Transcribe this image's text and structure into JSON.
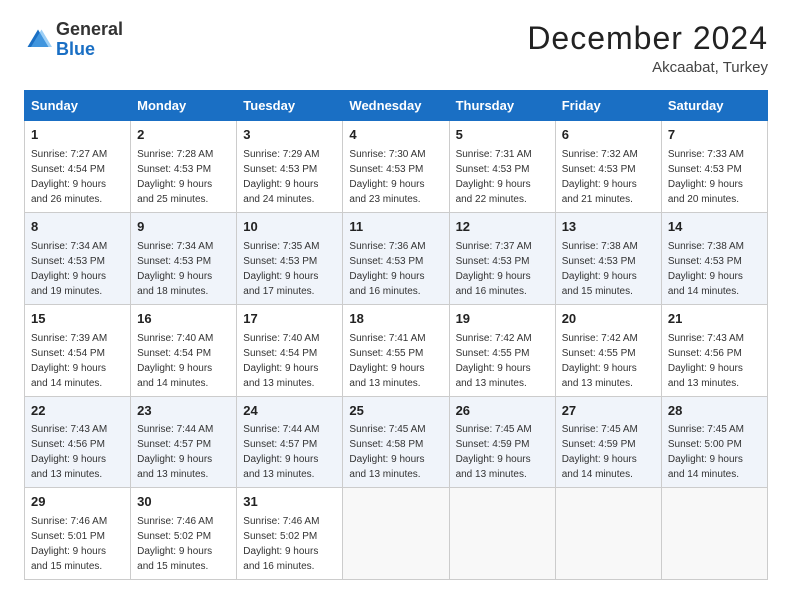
{
  "logo": {
    "general": "General",
    "blue": "Blue"
  },
  "title": {
    "month": "December 2024",
    "location": "Akcaabat, Turkey"
  },
  "weekdays": [
    "Sunday",
    "Monday",
    "Tuesday",
    "Wednesday",
    "Thursday",
    "Friday",
    "Saturday"
  ],
  "weeks": [
    [
      {
        "day": 1,
        "sunrise": "7:27 AM",
        "sunset": "4:54 PM",
        "daylight": "9 hours and 26 minutes."
      },
      {
        "day": 2,
        "sunrise": "7:28 AM",
        "sunset": "4:53 PM",
        "daylight": "9 hours and 25 minutes."
      },
      {
        "day": 3,
        "sunrise": "7:29 AM",
        "sunset": "4:53 PM",
        "daylight": "9 hours and 24 minutes."
      },
      {
        "day": 4,
        "sunrise": "7:30 AM",
        "sunset": "4:53 PM",
        "daylight": "9 hours and 23 minutes."
      },
      {
        "day": 5,
        "sunrise": "7:31 AM",
        "sunset": "4:53 PM",
        "daylight": "9 hours and 22 minutes."
      },
      {
        "day": 6,
        "sunrise": "7:32 AM",
        "sunset": "4:53 PM",
        "daylight": "9 hours and 21 minutes."
      },
      {
        "day": 7,
        "sunrise": "7:33 AM",
        "sunset": "4:53 PM",
        "daylight": "9 hours and 20 minutes."
      }
    ],
    [
      {
        "day": 8,
        "sunrise": "7:34 AM",
        "sunset": "4:53 PM",
        "daylight": "9 hours and 19 minutes."
      },
      {
        "day": 9,
        "sunrise": "7:34 AM",
        "sunset": "4:53 PM",
        "daylight": "9 hours and 18 minutes."
      },
      {
        "day": 10,
        "sunrise": "7:35 AM",
        "sunset": "4:53 PM",
        "daylight": "9 hours and 17 minutes."
      },
      {
        "day": 11,
        "sunrise": "7:36 AM",
        "sunset": "4:53 PM",
        "daylight": "9 hours and 16 minutes."
      },
      {
        "day": 12,
        "sunrise": "7:37 AM",
        "sunset": "4:53 PM",
        "daylight": "9 hours and 16 minutes."
      },
      {
        "day": 13,
        "sunrise": "7:38 AM",
        "sunset": "4:53 PM",
        "daylight": "9 hours and 15 minutes."
      },
      {
        "day": 14,
        "sunrise": "7:38 AM",
        "sunset": "4:53 PM",
        "daylight": "9 hours and 14 minutes."
      }
    ],
    [
      {
        "day": 15,
        "sunrise": "7:39 AM",
        "sunset": "4:54 PM",
        "daylight": "9 hours and 14 minutes."
      },
      {
        "day": 16,
        "sunrise": "7:40 AM",
        "sunset": "4:54 PM",
        "daylight": "9 hours and 14 minutes."
      },
      {
        "day": 17,
        "sunrise": "7:40 AM",
        "sunset": "4:54 PM",
        "daylight": "9 hours and 13 minutes."
      },
      {
        "day": 18,
        "sunrise": "7:41 AM",
        "sunset": "4:55 PM",
        "daylight": "9 hours and 13 minutes."
      },
      {
        "day": 19,
        "sunrise": "7:42 AM",
        "sunset": "4:55 PM",
        "daylight": "9 hours and 13 minutes."
      },
      {
        "day": 20,
        "sunrise": "7:42 AM",
        "sunset": "4:55 PM",
        "daylight": "9 hours and 13 minutes."
      },
      {
        "day": 21,
        "sunrise": "7:43 AM",
        "sunset": "4:56 PM",
        "daylight": "9 hours and 13 minutes."
      }
    ],
    [
      {
        "day": 22,
        "sunrise": "7:43 AM",
        "sunset": "4:56 PM",
        "daylight": "9 hours and 13 minutes."
      },
      {
        "day": 23,
        "sunrise": "7:44 AM",
        "sunset": "4:57 PM",
        "daylight": "9 hours and 13 minutes."
      },
      {
        "day": 24,
        "sunrise": "7:44 AM",
        "sunset": "4:57 PM",
        "daylight": "9 hours and 13 minutes."
      },
      {
        "day": 25,
        "sunrise": "7:45 AM",
        "sunset": "4:58 PM",
        "daylight": "9 hours and 13 minutes."
      },
      {
        "day": 26,
        "sunrise": "7:45 AM",
        "sunset": "4:59 PM",
        "daylight": "9 hours and 13 minutes."
      },
      {
        "day": 27,
        "sunrise": "7:45 AM",
        "sunset": "4:59 PM",
        "daylight": "9 hours and 14 minutes."
      },
      {
        "day": 28,
        "sunrise": "7:45 AM",
        "sunset": "5:00 PM",
        "daylight": "9 hours and 14 minutes."
      }
    ],
    [
      {
        "day": 29,
        "sunrise": "7:46 AM",
        "sunset": "5:01 PM",
        "daylight": "9 hours and 15 minutes."
      },
      {
        "day": 30,
        "sunrise": "7:46 AM",
        "sunset": "5:02 PM",
        "daylight": "9 hours and 15 minutes."
      },
      {
        "day": 31,
        "sunrise": "7:46 AM",
        "sunset": "5:02 PM",
        "daylight": "9 hours and 16 minutes."
      },
      null,
      null,
      null,
      null
    ]
  ],
  "labels": {
    "sunrise": "Sunrise:",
    "sunset": "Sunset:",
    "daylight": "Daylight:"
  }
}
